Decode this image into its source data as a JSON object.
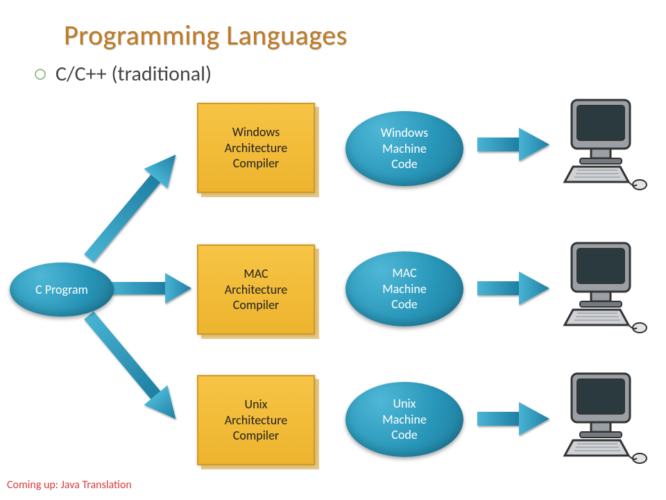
{
  "title": "Programming Languages",
  "bullet": "C/C++ (traditional)",
  "footer": "Coming up: Java Translation",
  "nodes": {
    "source": {
      "label": "C Program"
    },
    "comp_win": {
      "label": "Windows\nArchitecture\nCompiler"
    },
    "comp_mac": {
      "label": "MAC\nArchitecture\nCompiler"
    },
    "comp_unix": {
      "label": "Unix\nArchitecture\nCompiler"
    },
    "code_win": {
      "label": "Windows\nMachine\nCode"
    },
    "code_mac": {
      "label": "MAC\nMachine\nCode"
    },
    "code_unix": {
      "label": "Unix\nMachine\nCode"
    }
  },
  "colors": {
    "accent_teal": "#2f9abc",
    "accent_arrow": "#1f7fa3",
    "accent_yellow": "#f0b731",
    "title_color": "#c07a22"
  }
}
